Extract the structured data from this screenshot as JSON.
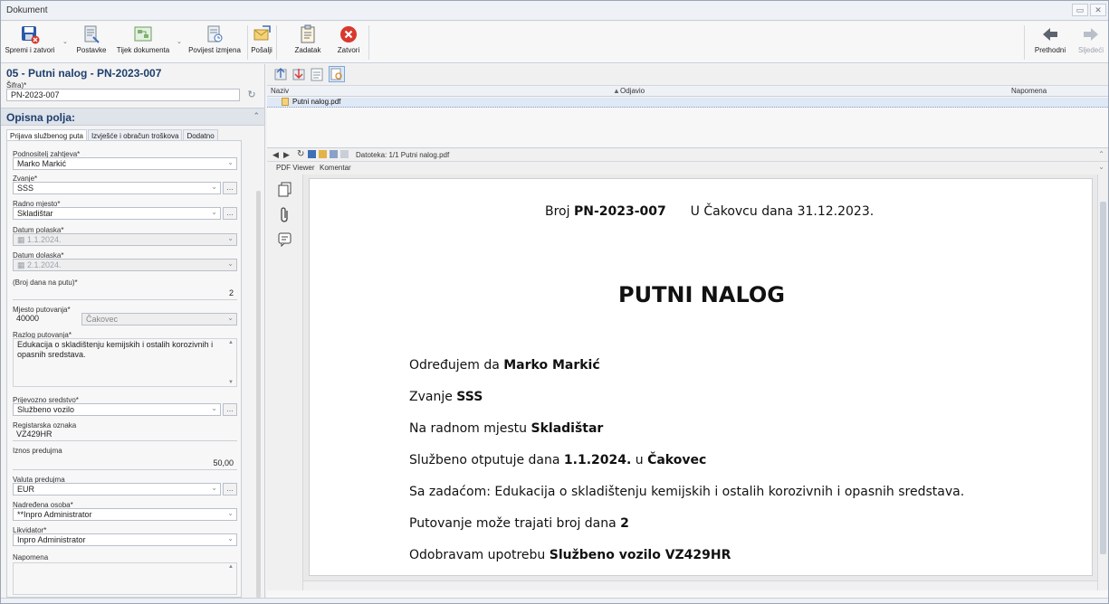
{
  "window": {
    "title": "Dokument",
    "controls": [
      "▭",
      "✕"
    ]
  },
  "ribbon": {
    "buttons": [
      {
        "label": "Spremi i zatvori",
        "icon": "save-close-icon"
      },
      {
        "label": "Postavke",
        "icon": "settings-icon"
      },
      {
        "label": "Tijek dokumenta",
        "icon": "workflow-icon"
      },
      {
        "label": "Povijest izmjena",
        "icon": "history-icon"
      },
      {
        "label": "Pošalji",
        "icon": "send-icon"
      },
      {
        "label": "Zadatak",
        "icon": "task-icon"
      },
      {
        "label": "Zatvori",
        "icon": "close-icon"
      },
      {
        "label": "Prethodni",
        "icon": "arrow-left-icon"
      },
      {
        "label": "Sljedeći",
        "icon": "arrow-right-icon"
      }
    ]
  },
  "left": {
    "title": "05 - Putni nalog - PN-2023-007",
    "sifra_label": "Šifra)*",
    "sifra_value": "PN-2023-007",
    "opisna_title": "Opisna polja:",
    "tabs": [
      "Prijava službenog puta",
      "Izvješće i obračun troškova",
      "Dodatno"
    ],
    "fields": {
      "podnositelj_label": "Podnositelj zahtjeva*",
      "podnositelj_value": "Marko Markić",
      "zvanje_label": "Zvanje*",
      "zvanje_value": "SSS",
      "radno_label": "Radno mjesto*",
      "radno_value": "Skladištar",
      "polaska_label": "Datum polaska*",
      "polaska_value": "1.1.2024.",
      "dolaska_label": "Datum dolaska*",
      "dolaska_value": "2.1.2024.",
      "broj_dana_label": "(Broj dana na putu)*",
      "broj_dana_value": "2",
      "mjesto_label": "Mjesto putovanja*",
      "mjesto_code": "40000",
      "mjesto_name": "Čakovec",
      "razlog_label": "Razlog putovanja*",
      "razlog_value": "Edukacija o skladištenju kemijskih i ostalih korozivnih i opasnih sredstava.",
      "prijevozno_label": "Prijevozno sredstvo*",
      "prijevozno_value": "Službeno vozilo",
      "registarska_label": "Registarska oznaka",
      "registarska_value": "VZ429HR",
      "iznos_label": "Iznos predujma",
      "iznos_value": "50,00",
      "valuta_label": "Valuta predujma",
      "valuta_value": "EUR",
      "nadredena_label": "Nadređena osoba*",
      "nadredena_value": "**Inpro Administrator",
      "likvidator_label": "Likvidator*",
      "likvidator_value": "Inpro Administrator",
      "napomena_label": "Napomena"
    }
  },
  "right": {
    "columns": {
      "naziv": "Naziv",
      "odjavio": "Odjavio",
      "napomena": "Napomena"
    },
    "file_row": "Putni nalog.pdf",
    "pdf_toolbar_text": "Datoteka: 1/1 Putni nalog.pdf",
    "pdf_tabs": [
      "PDF Viewer",
      "Komentar"
    ],
    "pdf": {
      "header_broj_prefix": "Broj",
      "header_broj_value": "PN-2023-007",
      "header_city_date": "U Čakovcu dana 31.12.2023.",
      "title": "PUTNI NALOG",
      "line1_prefix": "Određujem da",
      "line1_value": "Marko Markić",
      "line2_prefix": "Zvanje",
      "line2_value": "SSS",
      "line3_prefix": "Na radnom mjestu",
      "line3_value": "Skladištar",
      "line4_prefix": "Službeno otputuje dana",
      "line4_date": "1.1.2024.",
      "line4_mid": "u",
      "line4_city": "Čakovec",
      "line5": "Sa zadaćom: Edukacija o skladištenju kemijskih i ostalih korozivnih i opasnih sredstava.",
      "line6_prefix": "Putovanje može trajati broj dana",
      "line6_value": "2",
      "line7_prefix": "Odobravam upotrebu",
      "line7_value": "Službeno vozilo VZ429HR"
    }
  }
}
